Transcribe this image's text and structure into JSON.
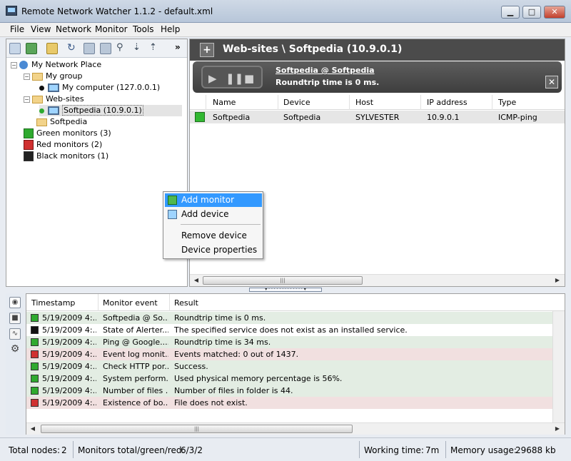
{
  "window": {
    "title": "Remote Network Watcher 1.1.2 - default.xml",
    "minimize": "▁",
    "maximize": "□",
    "close": "✕"
  },
  "menu": [
    "File",
    "View",
    "Network",
    "Monitor",
    "Tools",
    "Help"
  ],
  "toolbar": {
    "more": "»"
  },
  "tree": {
    "root": "My Network Place",
    "my_group": "My group",
    "my_computer": "My computer (127.0.0.1)",
    "web_sites": "Web-sites",
    "softpedia_host": "Softpedia (10.9.0.1)",
    "softpedia_folder": "Softpedia",
    "green": "Green monitors (3)",
    "red": "Red monitors (2)",
    "black": "Black monitors (1)"
  },
  "right": {
    "header_title": "Web-sites \\ Softpedia (10.9.0.1)",
    "monitor_link": "Softpedia @ Softpedia",
    "roundtrip": "Roundtrip time is 0 ms.",
    "columns": [
      "Name",
      "Device",
      "Host",
      "IP address",
      "Type"
    ],
    "row": {
      "name": "Softpedia",
      "device": "Softpedia",
      "host": "SYLVESTER",
      "ip": "10.9.0.1",
      "type": "ICMP-ping"
    }
  },
  "context_menu": {
    "add_monitor": "Add monitor",
    "add_device": "Add device",
    "remove_device": "Remove device",
    "device_properties": "Device properties"
  },
  "log": {
    "columns": [
      "Timestamp",
      "Monitor event",
      "Result"
    ],
    "rows": [
      {
        "status": "green",
        "ts": "5/19/2009 4:...",
        "event": "Softpedia @ So...",
        "result": "Roundtrip time is 0 ms."
      },
      {
        "status": "black",
        "ts": "5/19/2009 4:...",
        "event": "State of Alerter...",
        "result": "The specified service does not exist as an installed service."
      },
      {
        "status": "green",
        "ts": "5/19/2009 4:...",
        "event": "Ping @ Google....",
        "result": "Roundtrip time is 34 ms."
      },
      {
        "status": "red",
        "ts": "5/19/2009 4:...",
        "event": "Event log monit...",
        "result": "Events matched: 0 out of 1437."
      },
      {
        "status": "green",
        "ts": "5/19/2009 4:...",
        "event": "Check HTTP por...",
        "result": "Success."
      },
      {
        "status": "green",
        "ts": "5/19/2009 4:...",
        "event": "System perform...",
        "result": "Used physical memory percentage is 56%."
      },
      {
        "status": "green",
        "ts": "5/19/2009 4:...",
        "event": "Number of files ...",
        "result": "Number of files in folder is 44."
      },
      {
        "status": "red",
        "ts": "5/19/2009 4:...",
        "event": "Existence of bo...",
        "result": "File does not exist."
      }
    ]
  },
  "status": {
    "nodes_label": "Total nodes:",
    "nodes_value": "2",
    "monitors_label": "Monitors total/green/red:",
    "monitors_value": "6/3/2",
    "working_label": "Working time:",
    "working_value": "7m",
    "memory_label": "Memory usage:",
    "memory_value": "29688 kb"
  },
  "colors": {
    "green": "#2faa2f",
    "red": "#d03030",
    "black": "#111111",
    "header": "#4b4b4b",
    "selection": "#3399ff"
  }
}
